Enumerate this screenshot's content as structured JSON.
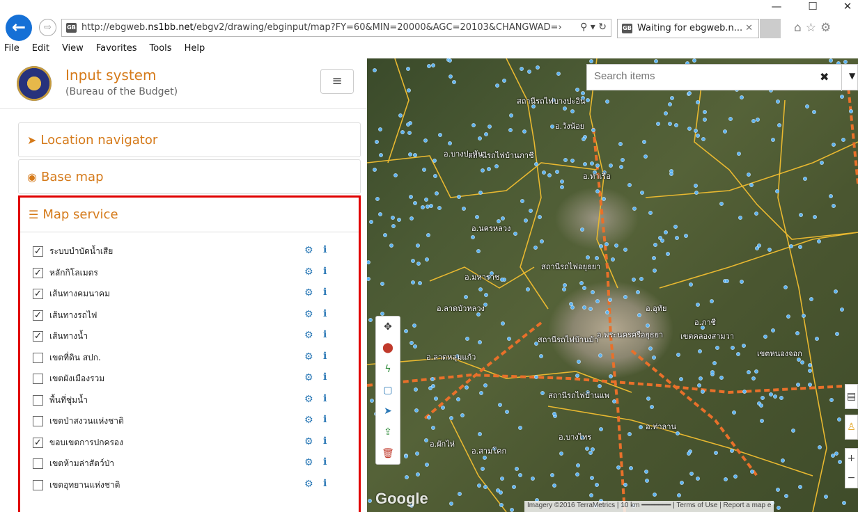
{
  "window": {
    "minimize": "—",
    "maximize": "☐",
    "close": "✕"
  },
  "browser": {
    "url_host_prefix": "http://ebgweb.",
    "url_host_bold": "ns1bb.net",
    "url_rest": "/ebgv2/drawing/ebginput/map?FY=60&MIN=20000&AGC=20103&CHANGWAD=›",
    "tab_title": "Waiting for ebgweb.n...",
    "favicon": "GB",
    "menu": [
      "File",
      "Edit",
      "View",
      "Favorites",
      "Tools",
      "Help"
    ]
  },
  "sidebar": {
    "title": "Input system",
    "subtitle": "(Bureau of the Budget)",
    "panels": {
      "location": "Location navigator",
      "basemap": "Base map",
      "mapservice": "Map service"
    },
    "layers": [
      {
        "name": "ระบบบำบัดน้ำเสีย",
        "checked": true
      },
      {
        "name": "หลักกิโลเมตร",
        "checked": true
      },
      {
        "name": "เส้นทางคมนาคม",
        "checked": true
      },
      {
        "name": "เส้นทางรถไฟ",
        "checked": true
      },
      {
        "name": "เส้นทางน้ำ",
        "checked": true
      },
      {
        "name": "เขตที่ดิน สปก.",
        "checked": false
      },
      {
        "name": "เขตผังเมืองรวม",
        "checked": false
      },
      {
        "name": "พื้นที่ชุ่มน้ำ",
        "checked": false
      },
      {
        "name": "เขตป่าสงวนแห่งชาติ",
        "checked": false
      },
      {
        "name": "ขอบเขตการปกครอง",
        "checked": true
      },
      {
        "name": "เขตห้ามล่าสัตว์ป่า",
        "checked": false
      },
      {
        "name": "เขตอุทยานแห่งชาติ",
        "checked": false
      }
    ]
  },
  "map": {
    "search_placeholder": "Search items",
    "attribution": "Imagery ©2016 TerraMetrics | 10 km ━━━━━━━ | Terms of Use | Report a map e",
    "google": "Google",
    "labels": [
      "สถานีรถไฟบางปะอิน",
      "อ.วังน้อย",
      "สถานีรถไฟบ้านภาชี",
      "อ.บางปะหัน",
      "สถานีรถไฟอยุธยา",
      "อ.ท่าเรือ",
      "อ.นครหลวง",
      "อ.พระนครศรีอยุธยา",
      "สถานีรถไฟบ้านม้า",
      "อ.มหาราช",
      "อ.อุทัย",
      "อ.ลาดบัวหลวง",
      "อ.ลาดหลุมแก้ว",
      "อ.สามโคก",
      "อ.ผักไห่",
      "อ.บางไทร",
      "สถานีรถไฟบ้านแพ",
      "อ.ภาชี",
      "อ.ท่าลาน",
      "เขตคลองสามวา",
      "เขตหนองจอก"
    ]
  }
}
